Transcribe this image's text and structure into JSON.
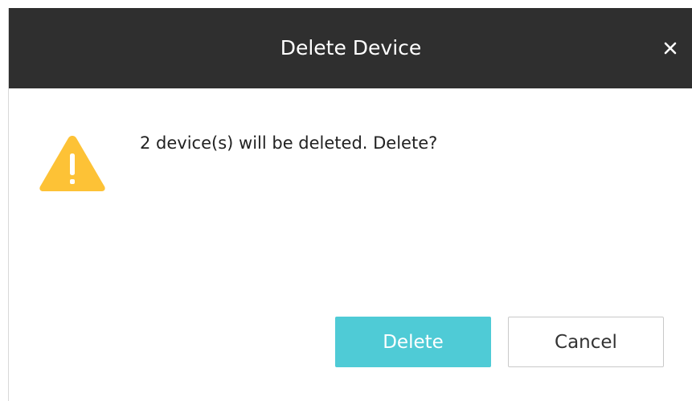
{
  "dialog": {
    "title": "Delete Device",
    "message": "2 device(s) will be deleted. Delete?",
    "icons": {
      "close": "close-icon",
      "warning": "warning-icon"
    }
  },
  "buttons": {
    "delete_label": "Delete",
    "cancel_label": "Cancel"
  },
  "colors": {
    "title_bar": "#2f2f2f",
    "primary_button": "#4fcbd6",
    "warning": "#fdc236"
  }
}
